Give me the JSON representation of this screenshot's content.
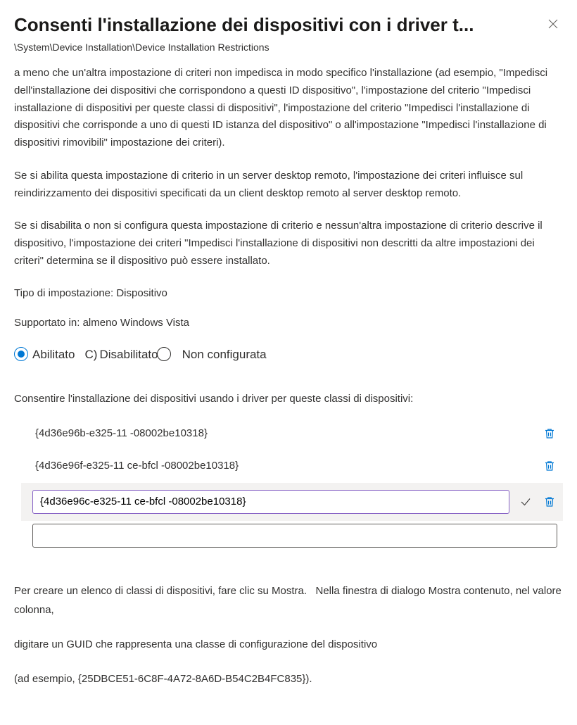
{
  "header": {
    "title": "Consenti l'installazione dei dispositivi con i driver t...",
    "breadcrumb": "\\System\\Device Installation\\Device Installation Restrictions"
  },
  "description": {
    "p1": "a meno che un'altra impostazione di criteri non impedisca in modo specifico l'installazione (ad esempio, \"Impedisci dell'installazione dei dispositivi che corrispondono a questi ID dispositivo\", l'impostazione del criterio \"Impedisci installazione di dispositivi per queste classi di dispositivi\", l'impostazione del criterio \"Impedisci l'installazione di dispositivi che corrisponde a uno di questi ID istanza del dispositivo\" o all'impostazione \"Impedisci l'installazione di dispositivi rimovibili\" impostazione dei criteri).",
    "p2": "Se si abilita questa impostazione di criterio in un server desktop remoto, l'impostazione dei criteri influisce sul reindirizzamento dei dispositivi specificati da un client desktop remoto al server desktop remoto.",
    "p3": "Se si disabilita o non si configura questa impostazione di criterio e nessun'altra impostazione di criterio descrive il dispositivo, l'impostazione dei criteri \"Impedisci l'installazione di dispositivi non descritti da altre impostazioni dei criteri\" determina se il dispositivo può essere installato."
  },
  "setting_type_label": "Tipo di impostazione: Dispositivo",
  "supported_label": "Supportato in: almeno Windows Vista",
  "radio": {
    "enabled": "Abilitato",
    "disabled": "Disabilitato",
    "not_configured": "Non configurata"
  },
  "list_section_label": "Consentire l'installazione dei dispositivi usando i driver per queste classi di dispositivi:",
  "list_items": {
    "item0": "{4d36e96b-e325-11 -08002be10318}",
    "item1": "{4d36e96f-e325-11 ce-bfcl -08002be10318}",
    "item2": "{4d36e96c-e325-11 ce-bfcl -08002be10318}"
  },
  "footer": {
    "p1": "Per creare un elenco di classi di dispositivi, fare clic su Mostra.   Nella finestra di dialogo Mostra contenuto, nel valore colonna,",
    "p2": "digitare un GUID che rappresenta una classe di configurazione del dispositivo",
    "p3": "(ad esempio, {25DBCE51-6C8F-4A72-8A6D-B54C2B4FC835})."
  }
}
